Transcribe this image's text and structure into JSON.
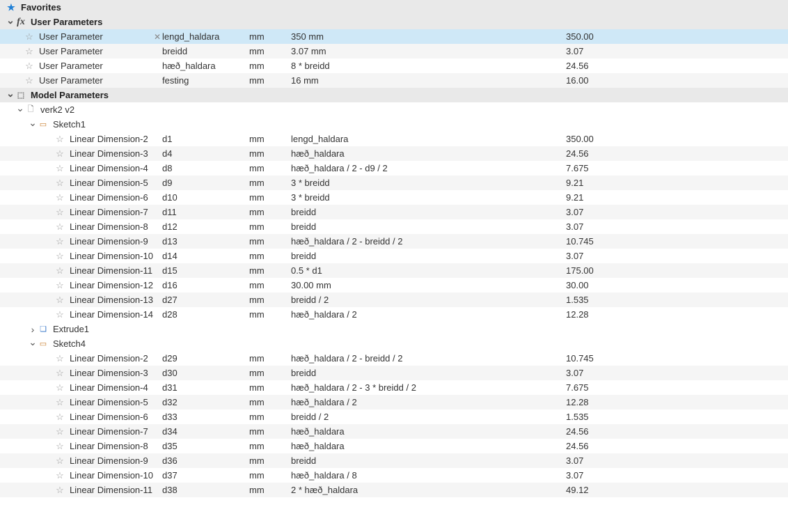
{
  "sections": {
    "favorites": "Favorites",
    "userParameters": "User Parameters",
    "modelParameters": "Model Parameters"
  },
  "userParamLabel": "User Parameter",
  "userParams": [
    {
      "param": "lengd_haldara",
      "unit": "mm",
      "expr": "350 mm",
      "value": "350.00",
      "selected": true
    },
    {
      "param": "breidd",
      "unit": "mm",
      "expr": "3.07 mm",
      "value": "3.07"
    },
    {
      "param": "hæð_haldara",
      "unit": "mm",
      "expr": "8 * breidd",
      "value": "24.56"
    },
    {
      "param": "festing",
      "unit": "mm",
      "expr": "16 mm",
      "value": "16.00"
    }
  ],
  "modelTree": {
    "root": "verk2 v2",
    "sketch1": "Sketch1",
    "extrude1": "Extrude1",
    "sketch4": "Sketch4"
  },
  "sketch1Params": [
    {
      "name": "Linear Dimension-2",
      "param": "d1",
      "unit": "mm",
      "expr": "lengd_haldara",
      "value": "350.00"
    },
    {
      "name": "Linear Dimension-3",
      "param": "d4",
      "unit": "mm",
      "expr": "hæð_haldara",
      "value": "24.56"
    },
    {
      "name": "Linear Dimension-4",
      "param": "d8",
      "unit": "mm",
      "expr": "hæð_haldara / 2 - d9 / 2",
      "value": "7.675"
    },
    {
      "name": "Linear Dimension-5",
      "param": "d9",
      "unit": "mm",
      "expr": "3 * breidd",
      "value": "9.21"
    },
    {
      "name": "Linear Dimension-6",
      "param": "d10",
      "unit": "mm",
      "expr": "3 * breidd",
      "value": "9.21"
    },
    {
      "name": "Linear Dimension-7",
      "param": "d11",
      "unit": "mm",
      "expr": "breidd",
      "value": "3.07"
    },
    {
      "name": "Linear Dimension-8",
      "param": "d12",
      "unit": "mm",
      "expr": "breidd",
      "value": "3.07"
    },
    {
      "name": "Linear Dimension-9",
      "param": "d13",
      "unit": "mm",
      "expr": "hæð_haldara / 2 - breidd / 2",
      "value": "10.745"
    },
    {
      "name": "Linear Dimension-10",
      "param": "d14",
      "unit": "mm",
      "expr": "breidd",
      "value": "3.07"
    },
    {
      "name": "Linear Dimension-11",
      "param": "d15",
      "unit": "mm",
      "expr": "0.5 * d1",
      "value": "175.00"
    },
    {
      "name": "Linear Dimension-12",
      "param": "d16",
      "unit": "mm",
      "expr": "30.00 mm",
      "value": "30.00"
    },
    {
      "name": "Linear Dimension-13",
      "param": "d27",
      "unit": "mm",
      "expr": "breidd / 2",
      "value": "1.535"
    },
    {
      "name": "Linear Dimension-14",
      "param": "d28",
      "unit": "mm",
      "expr": "hæð_haldara / 2",
      "value": "12.28"
    }
  ],
  "sketch4Params": [
    {
      "name": "Linear Dimension-2",
      "param": "d29",
      "unit": "mm",
      "expr": "hæð_haldara / 2 - breidd / 2",
      "value": "10.745"
    },
    {
      "name": "Linear Dimension-3",
      "param": "d30",
      "unit": "mm",
      "expr": "breidd",
      "value": "3.07"
    },
    {
      "name": "Linear Dimension-4",
      "param": "d31",
      "unit": "mm",
      "expr": "hæð_haldara / 2 - 3 * breidd / 2",
      "value": "7.675"
    },
    {
      "name": "Linear Dimension-5",
      "param": "d32",
      "unit": "mm",
      "expr": "hæð_haldara / 2",
      "value": "12.28"
    },
    {
      "name": "Linear Dimension-6",
      "param": "d33",
      "unit": "mm",
      "expr": "breidd / 2",
      "value": "1.535"
    },
    {
      "name": "Linear Dimension-7",
      "param": "d34",
      "unit": "mm",
      "expr": "hæð_haldara",
      "value": "24.56"
    },
    {
      "name": "Linear Dimension-8",
      "param": "d35",
      "unit": "mm",
      "expr": "hæð_haldara",
      "value": "24.56"
    },
    {
      "name": "Linear Dimension-9",
      "param": "d36",
      "unit": "mm",
      "expr": "breidd",
      "value": "3.07"
    },
    {
      "name": "Linear Dimension-10",
      "param": "d37",
      "unit": "mm",
      "expr": "hæð_haldara / 8",
      "value": "3.07"
    },
    {
      "name": "Linear Dimension-11",
      "param": "d38",
      "unit": "mm",
      "expr": "2 * hæð_haldara",
      "value": "49.12"
    }
  ]
}
